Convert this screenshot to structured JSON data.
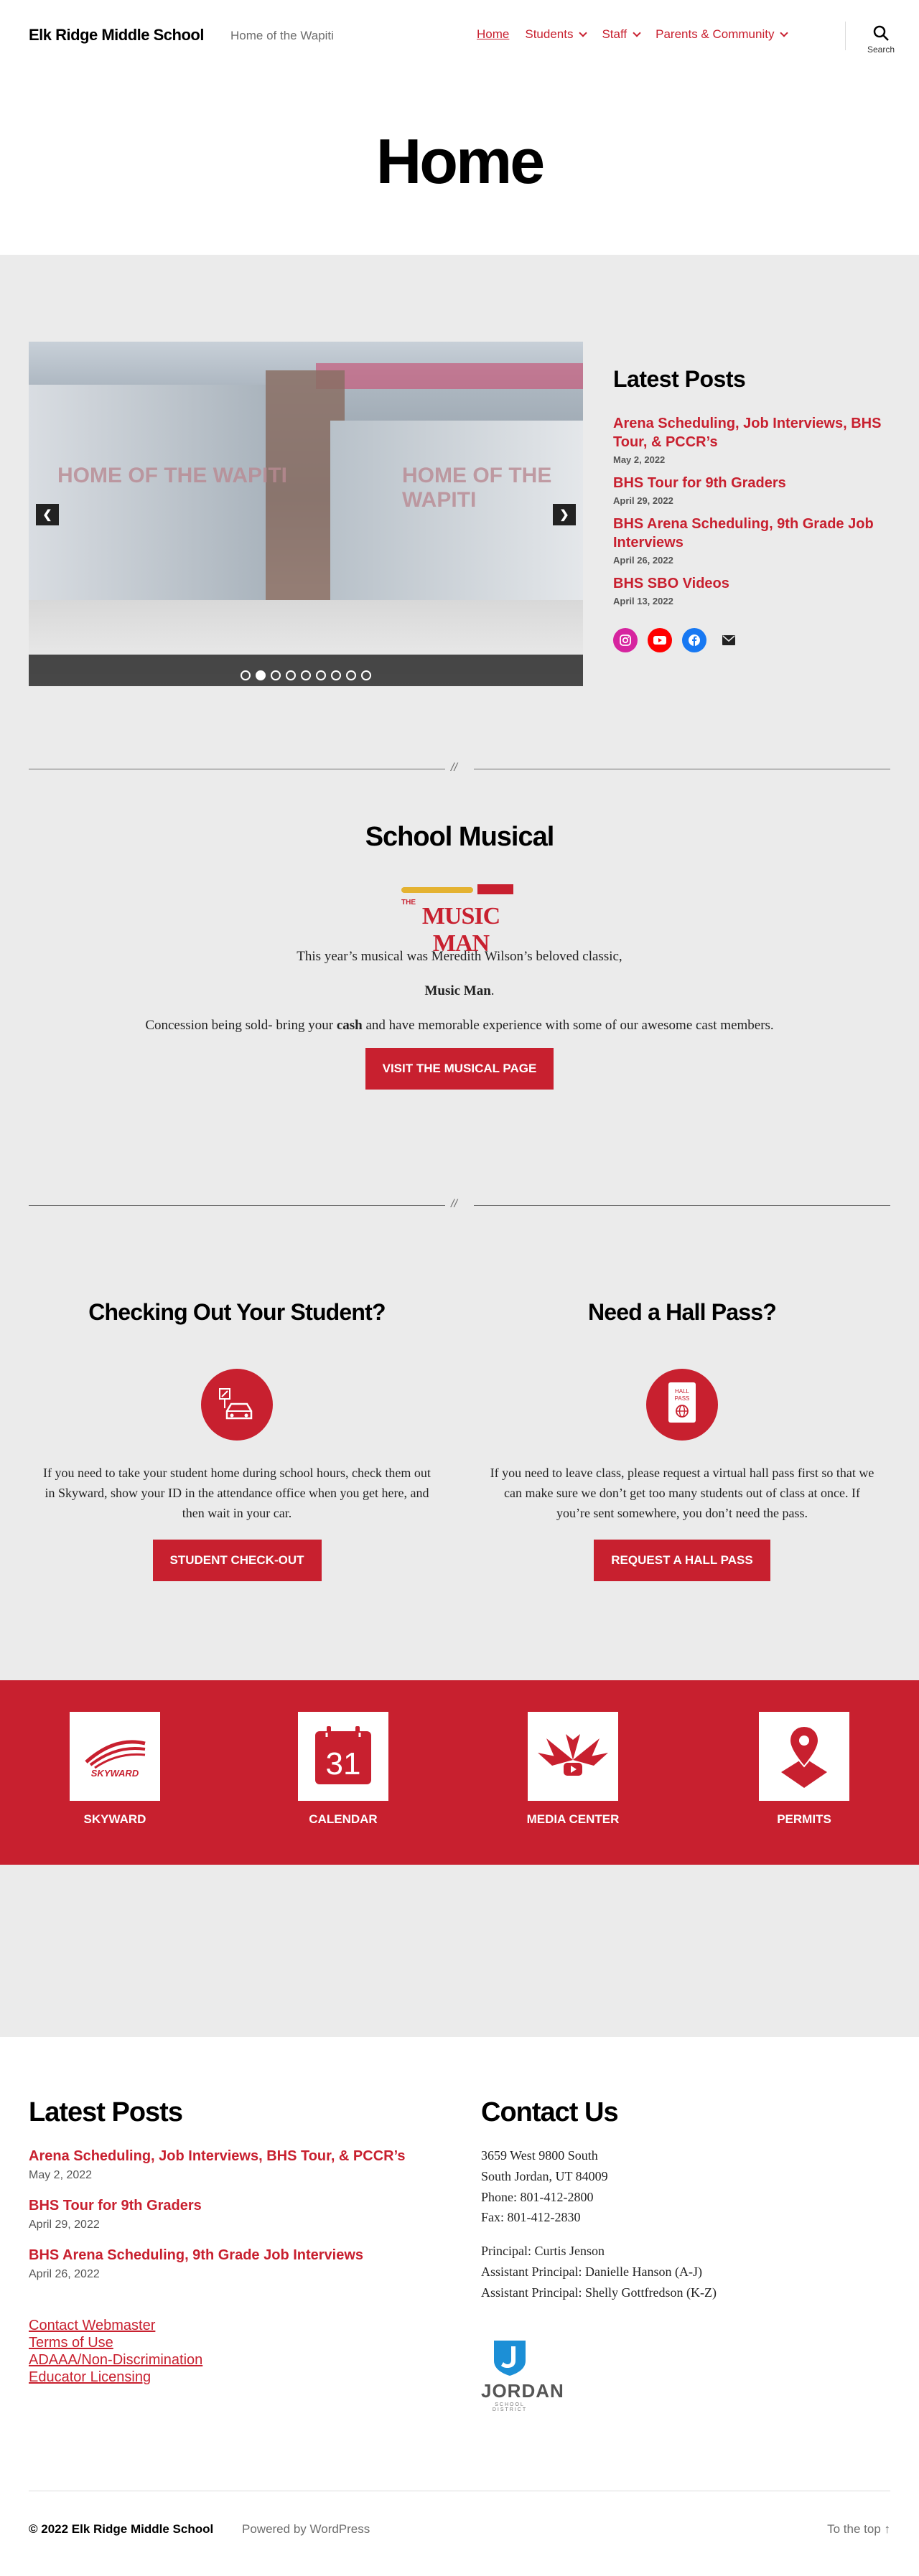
{
  "header": {
    "site_title": "Elk Ridge Middle School",
    "site_description": "Home of the Wapiti",
    "nav": [
      {
        "label": "Home",
        "current": true,
        "has_children": false
      },
      {
        "label": "Students",
        "has_children": true
      },
      {
        "label": "Staff",
        "has_children": true
      },
      {
        "label": "Parents & Community",
        "has_children": true
      }
    ],
    "search_label": "Search"
  },
  "page": {
    "title": "Home"
  },
  "slider": {
    "sign_left": "HOME OF THE WAPITI",
    "sign_right": "HOME OF THE WAPITI",
    "slide_count": 9,
    "active_slide": 2,
    "prev_icon": "chevron-left-icon",
    "next_icon": "chevron-right-icon"
  },
  "latest_posts": {
    "heading": "Latest Posts",
    "posts": [
      {
        "title": "Arena Scheduling, Job Interviews, BHS Tour, & PCCR’s",
        "date": "May 2, 2022"
      },
      {
        "title": "BHS Tour for 9th Graders",
        "date": "April 29, 2022"
      },
      {
        "title": "BHS Arena Scheduling, 9th Grade Job Interviews",
        "date": "April 26, 2022"
      },
      {
        "title": "BHS SBO Videos",
        "date": "April 13, 2022"
      }
    ],
    "socials": [
      "instagram-icon",
      "youtube-icon",
      "facebook-icon",
      "mail-icon"
    ]
  },
  "separator_mark": "//",
  "musical": {
    "heading": "School Musical",
    "logo_the": "THE",
    "logo_main": "MUSIC MAN",
    "line1": "This year’s musical was Meredith Wilson’s beloved classic,",
    "line2": "Music Man",
    "line2_suffix": ".",
    "line3_prefix": "Concession being sold- bring your ",
    "line3_bold": "cash",
    "line3_suffix": " and have memorable experience with some of our awesome cast members.",
    "button": "VISIT THE MUSICAL PAGE"
  },
  "checkout": {
    "heading": "Checking Out Your Student?",
    "icon": "car-checkout-icon",
    "text": "If you need to take your student home during school hours, check them out in Skyward, show your ID in the attendance office when you get here, and then wait in your car.",
    "button": "STUDENT CHECK-OUT"
  },
  "hall_pass": {
    "heading": "Need a Hall Pass?",
    "icon": "hall-pass-icon",
    "icon_text": "HALL PASS",
    "text": "If you need to leave class, please request a virtual hall pass first so that we can make sure we don’t get too many students out of class at once. If you’re sent somewhere, you don’t need the pass.",
    "button": "REQUEST A HALL PASS"
  },
  "quick_links": [
    {
      "label": "SKYWARD",
      "icon": "skyward-logo-icon",
      "icon_text": "SKYWARD"
    },
    {
      "label": "CALENDAR",
      "icon": "calendar-icon",
      "icon_text": "31"
    },
    {
      "label": "MEDIA CENTER",
      "icon": "media-center-icon",
      "icon_text": ""
    },
    {
      "label": "PERMITS",
      "icon": "map-pin-icon",
      "icon_text": ""
    }
  ],
  "footer": {
    "latest_heading": "Latest Posts",
    "posts": [
      {
        "title": "Arena Scheduling, Job Interviews, BHS Tour, & PCCR’s",
        "date": "May 2, 2022"
      },
      {
        "title": "BHS Tour for 9th Graders",
        "date": "April 29, 2022"
      },
      {
        "title": "BHS Arena Scheduling, 9th Grade Job Interviews",
        "date": "April 26, 2022"
      }
    ],
    "links": [
      "Contact Webmaster",
      "Terms of Use",
      "ADAAA/Non-Discrimination",
      "Educator Licensing"
    ],
    "contact_heading": "Contact Us",
    "address1": "3659 West 9800 South",
    "address2": "South Jordan, UT 84009",
    "phone": "Phone: 801-412-2800",
    "fax": "Fax: 801-412-2830",
    "principal": "Principal: Curtis Jenson",
    "ap1": "Assistant Principal: Danielle Hanson (A-J)",
    "ap2": "Assistant Principal: Shelly Gottfredson (K-Z)",
    "district_logo_word": "JORDAN",
    "district_logo_sub": "SCHOOL DISTRICT",
    "copyright": "© 2022 Elk Ridge Middle School",
    "powered": "Powered by WordPress",
    "to_top": "To the top ↑"
  },
  "colors": {
    "accent_red": "#c8202f",
    "grey_band": "#ebebeb"
  }
}
